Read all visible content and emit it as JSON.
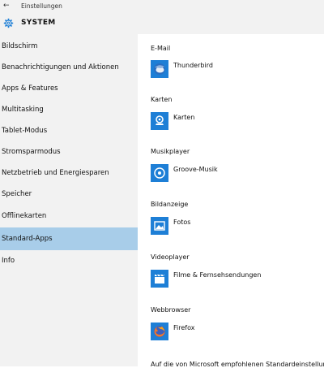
{
  "window": {
    "title": "Einstellungen",
    "back_icon": "back-arrow-icon"
  },
  "header": {
    "title": "SYSTEM",
    "icon": "gear-icon"
  },
  "sidebar": {
    "items": [
      {
        "label": "Bildschirm"
      },
      {
        "label": "Benachrichtigungen und Aktionen"
      },
      {
        "label": "Apps & Features"
      },
      {
        "label": "Multitasking"
      },
      {
        "label": "Tablet-Modus"
      },
      {
        "label": "Stromsparmodus"
      },
      {
        "label": "Netzbetrieb und Energiesparen"
      },
      {
        "label": "Speicher"
      },
      {
        "label": "Offlinekarten"
      },
      {
        "label": "Standard-Apps",
        "selected": true
      },
      {
        "label": "Info"
      }
    ],
    "selected_color": "#a8cde9"
  },
  "main": {
    "categories": [
      {
        "label": "E-Mail",
        "app": "Thunderbird",
        "icon": "thunderbird-icon"
      },
      {
        "label": "Karten",
        "app": "Karten",
        "icon": "maps-icon"
      },
      {
        "label": "Musikplayer",
        "app": "Groove-Musik",
        "icon": "groove-music-icon"
      },
      {
        "label": "Bildanzeige",
        "app": "Fotos",
        "icon": "photos-icon"
      },
      {
        "label": "Videoplayer",
        "app": "Filme & Fernsehsendungen",
        "icon": "movies-tv-icon"
      },
      {
        "label": "Webbrowser",
        "app": "Firefox",
        "icon": "firefox-icon"
      }
    ],
    "footer": "Auf die von Microsoft empfohlenen Standardeinstellungen"
  }
}
